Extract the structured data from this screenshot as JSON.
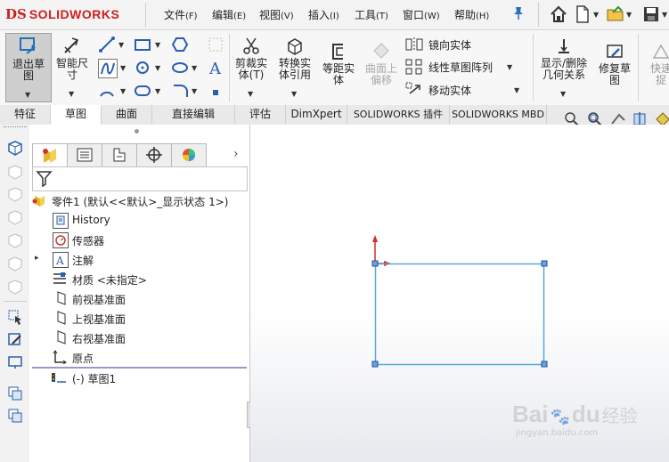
{
  "app": {
    "logo_ds": "DS",
    "logo_name": "SOLIDWORKS"
  },
  "menu": [
    {
      "label": "文件",
      "key": "(F)"
    },
    {
      "label": "编辑",
      "key": "(E)"
    },
    {
      "label": "视图",
      "key": "(V)"
    },
    {
      "label": "插入",
      "key": "(I)"
    },
    {
      "label": "工具",
      "key": "(T)"
    },
    {
      "label": "窗口",
      "key": "(W)"
    },
    {
      "label": "帮助",
      "key": "(H)"
    }
  ],
  "ribbon": {
    "exit_sketch": "退出草\n图",
    "smart_dimension": "智能尺\n寸",
    "trim": "剪裁实\n体(T)",
    "convert": "转换实\n体引用",
    "offset": "等距实\n体",
    "surface_offset": "曲面上\n偏移",
    "mirror": "镜向实体",
    "linear_pattern": "线性草图阵列",
    "move": "移动实体",
    "show_relations": "显示/删除\n几何关系",
    "repair": "修复草\n图",
    "quick_snap": "快速\n捉"
  },
  "tabs": [
    "特征",
    "草图",
    "曲面",
    "直接编辑",
    "评估",
    "DimXpert",
    "SOLIDWORKS 插件",
    "SOLIDWORKS MBD"
  ],
  "active_tab": "草图",
  "tree": {
    "root": "零件1  (默认<<默认>_显示状态 1>)",
    "items": [
      {
        "label": "History",
        "icon": "history-icon"
      },
      {
        "label": "传感器",
        "icon": "sensor-icon"
      },
      {
        "label": "注解",
        "icon": "annotation-icon"
      },
      {
        "label": "材质 <未指定>",
        "icon": "material-icon"
      },
      {
        "label": "前视基准面",
        "icon": "plane-icon"
      },
      {
        "label": "上视基准面",
        "icon": "plane-icon"
      },
      {
        "label": "右视基准面",
        "icon": "plane-icon"
      },
      {
        "label": "原点",
        "icon": "origin-icon"
      },
      {
        "label": "(-) 草图1",
        "icon": "sketch-icon"
      }
    ]
  },
  "watermark": {
    "brand": "Bai",
    "paw": "du",
    "cn": "经验",
    "url": "jingyan.baidu.com"
  },
  "colors": {
    "accent": "#d01e1e",
    "sketch_line": "#5aa8dc",
    "vertex": "#1f4fa3",
    "origin": "#d52b2b"
  }
}
